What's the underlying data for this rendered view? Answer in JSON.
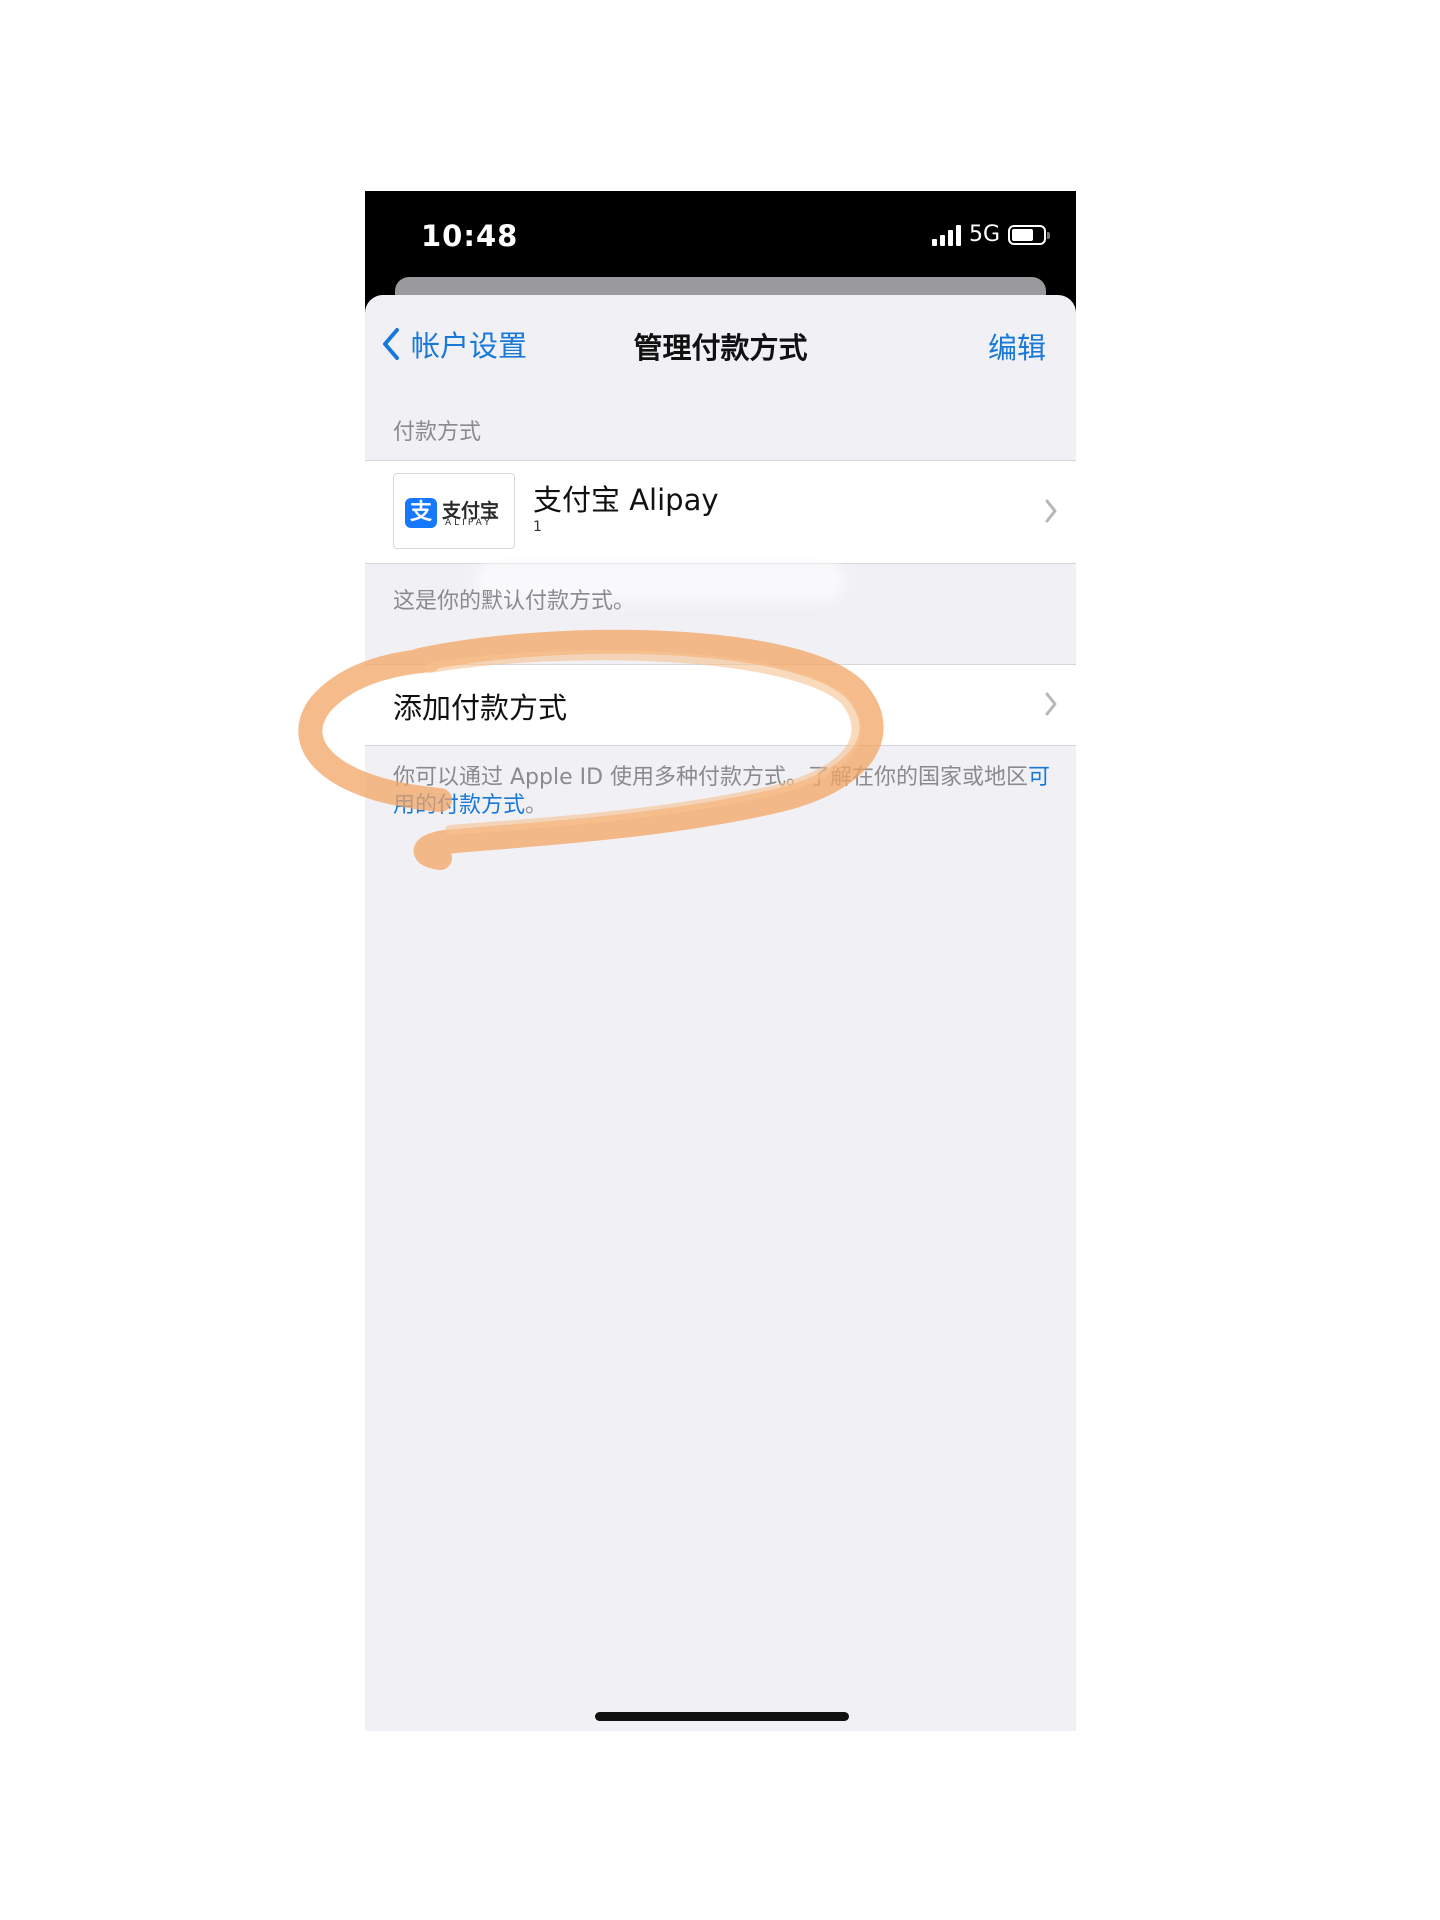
{
  "status_bar": {
    "time": "10:48",
    "network": "5G",
    "battery_level": 0.7,
    "signal_bars": 4
  },
  "nav": {
    "back_label": "帐户设置",
    "title": "管理付款方式",
    "edit_label": "编辑"
  },
  "payment_section": {
    "header": "付款方式",
    "method_name": "支付宝 Alipay",
    "method_sub": "1",
    "logo_mark": "支",
    "logo_cn": "支付宝",
    "logo_en": "ALIPAY",
    "default_note": "这是你的默认付款方式。"
  },
  "add_section": {
    "label": "添加付款方式",
    "footer_text": "你可以通过 Apple ID 使用多种付款方式。了解在你的国家或地区",
    "footer_link": "可用的付款方式",
    "footer_end": "。"
  },
  "colors": {
    "accent": "#1979d8",
    "background": "#f1f1f5",
    "highlight_stroke": "#f3a463"
  },
  "icons": {
    "back": "chevron-left-icon",
    "disclosure": "chevron-right-icon"
  }
}
